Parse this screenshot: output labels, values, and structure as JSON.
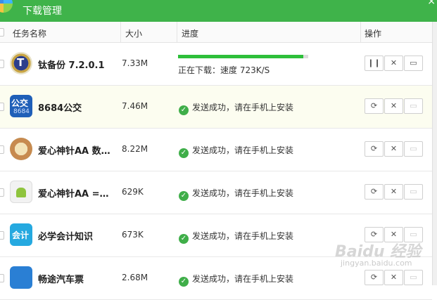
{
  "window": {
    "title": "下载管理",
    "close": "×"
  },
  "columns": {
    "name": "任务名称",
    "size": "大小",
    "progress": "进度",
    "actions": "操作"
  },
  "colors": {
    "accent": "#3fb34a",
    "progress": "#2ebf3a",
    "success": "#3fae49"
  },
  "rows": [
    {
      "name": "钛备份 7.2.0.1",
      "size": "7.33M",
      "state": "downloading",
      "progress_percent": 96,
      "status": "正在下载：速度 723K/S",
      "icon": "titanium-backup-icon",
      "badge": "T"
    },
    {
      "name": "8684公交",
      "size": "7.46M",
      "state": "done",
      "status": "发送成功，请在手机上安装",
      "icon": "bus-8684-icon",
      "badge": "公交",
      "badge_sub": "8684"
    },
    {
      "name": "爱心神针AA 数…",
      "size": "8.22M",
      "state": "done",
      "status": "发送成功，请在手机上安装",
      "icon": "love-needle-icon",
      "badge": ""
    },
    {
      "name": "爱心神针AA =…",
      "size": "629K",
      "state": "done",
      "status": "发送成功，请在手机上安装",
      "icon": "android-icon",
      "badge": ""
    },
    {
      "name": "必学会计知识",
      "size": "673K",
      "state": "done",
      "status": "发送成功，请在手机上安装",
      "icon": "accounting-icon",
      "badge": "会计"
    },
    {
      "name": "畅途汽车票",
      "size": "2.68M",
      "state": "done",
      "status": "发送成功，请在手机上安装",
      "icon": "bus-ticket-icon",
      "badge": ""
    }
  ],
  "watermark": {
    "text": "Baidu 经验",
    "sub": "jingyan.baidu.com"
  }
}
